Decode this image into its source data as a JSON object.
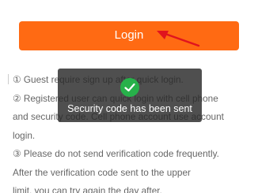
{
  "login_button": {
    "label": "Login",
    "color": "#ff6a13"
  },
  "annotation": {
    "icon": "red-arrow-icon",
    "color": "#e0141e"
  },
  "notes": [
    "① Guest require sign up after quick login.",
    "② Registered user can quick login with cell phone",
    "and security code. Cell phone account use account",
    "login.",
    "③ Please do not send verification code frequently.",
    "After the verification code sent to the upper",
    "limit, you can try again the day after."
  ],
  "toast": {
    "icon": "check-circle-icon",
    "icon_color": "#27b14a",
    "message": "Security code has been sent"
  }
}
